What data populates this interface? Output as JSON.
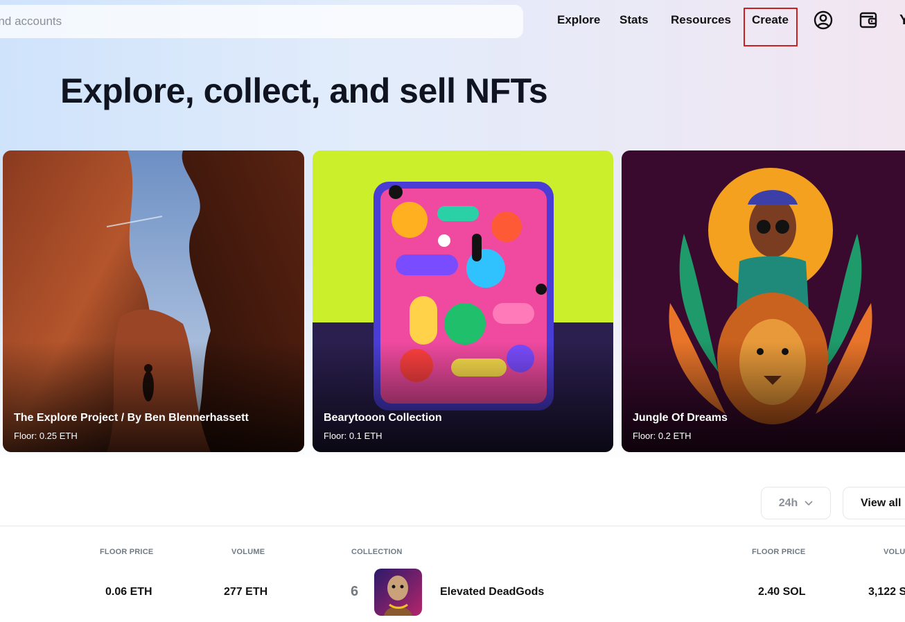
{
  "search": {
    "placeholder": "and accounts"
  },
  "nav": {
    "explore": "Explore",
    "stats": "Stats",
    "resources": "Resources",
    "create": "Create",
    "profile_icon": "account-circle-icon",
    "wallet_icon": "wallet-icon"
  },
  "hero": {
    "headline": "Explore, collect, and sell NFTs"
  },
  "cards": [
    {
      "title": "The Explore Project / By Ben Blennerhassett",
      "floor": "Floor: 0.25 ETH"
    },
    {
      "title": "Bearytooon Collection",
      "floor": "Floor: 0.1 ETH"
    },
    {
      "title": "Jungle Of Dreams",
      "floor": "Floor: 0.2 ETH"
    }
  ],
  "controls": {
    "range": "24h",
    "view_all": "View all"
  },
  "table": {
    "left_headers": {
      "floor_price": "FLOOR PRICE",
      "volume": "VOLUME"
    },
    "right_headers": {
      "collection": "COLLECTION",
      "floor_price": "FLOOR PRICE",
      "volume": "VOLU"
    },
    "left_row": {
      "floor_price": "0.06 ETH",
      "volume": "277 ETH"
    },
    "right_row": {
      "rank": "6",
      "name": "Elevated DeadGods",
      "floor_price": "2.40 SOL",
      "volume": "3,122 S"
    }
  },
  "colors": {
    "highlight": "#cc1f1f",
    "card2_bg": "#ccef2b",
    "card3_bg": "#3a0a2e"
  }
}
